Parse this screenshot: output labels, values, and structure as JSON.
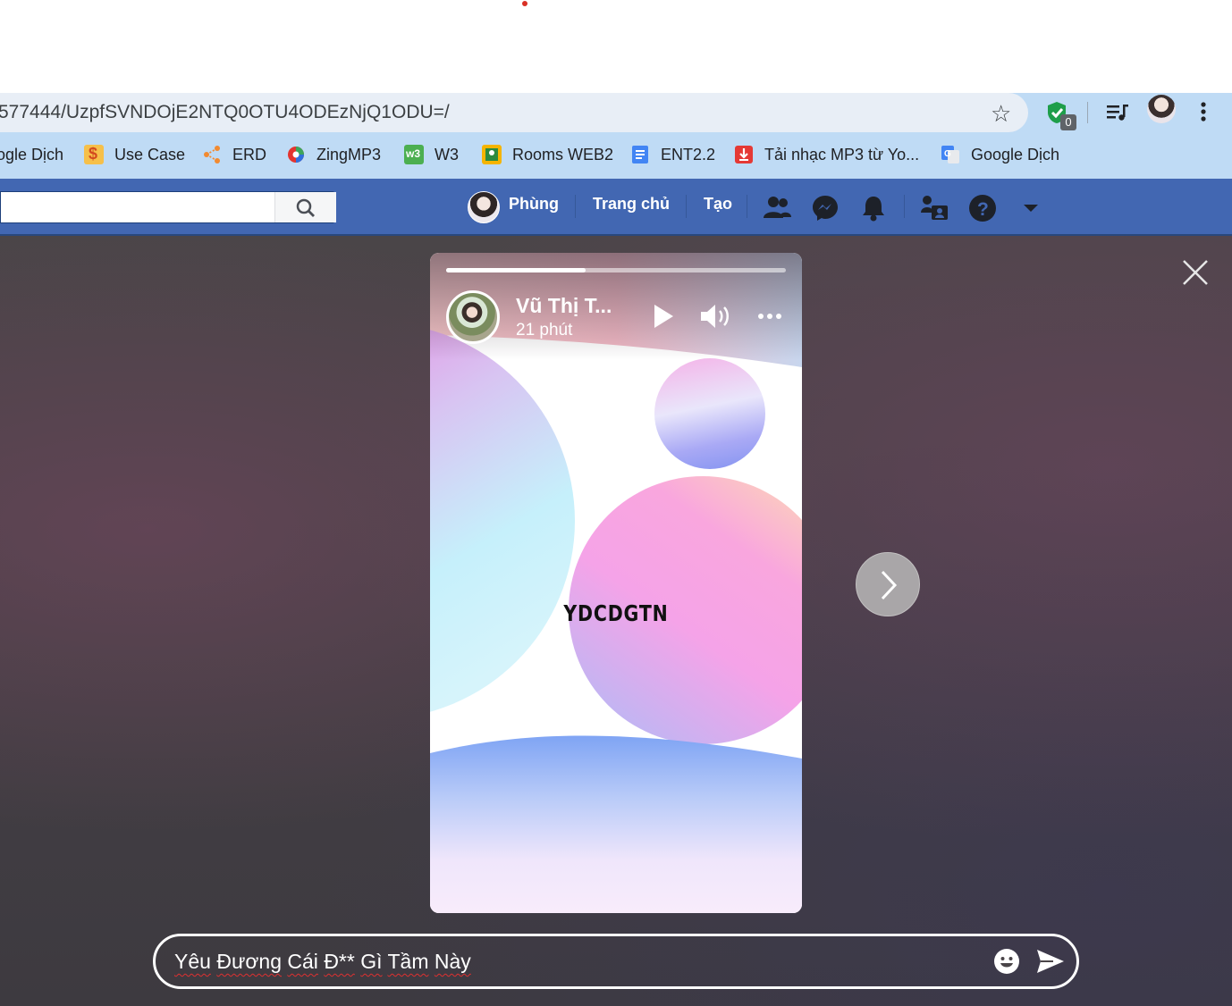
{
  "browser": {
    "url": "577444/UzpfSVNDOjE2NTQ0OTU4ODEzNjQ1ODU=/",
    "extension_badge": "0"
  },
  "bookmarks": [
    {
      "label": "ogle Dịch",
      "icon": "google-translate-icon"
    },
    {
      "label": "Use Case",
      "icon": "dollar-icon"
    },
    {
      "label": "ERD",
      "icon": "share-nodes-icon"
    },
    {
      "label": "ZingMP3",
      "icon": "zingmp3-icon"
    },
    {
      "label": "W3",
      "icon": "w3-icon"
    },
    {
      "label": "Rooms WEB2",
      "icon": "classroom-icon"
    },
    {
      "label": "ENT2.2",
      "icon": "docs-icon"
    },
    {
      "label": "Tải nhạc MP3 từ Yo...",
      "icon": "download-icon"
    },
    {
      "label": "Google Dịch",
      "icon": "google-translate-icon"
    }
  ],
  "facebook": {
    "user_name": "Phùng",
    "home": "Trang chủ",
    "create": "Tạo"
  },
  "story": {
    "author": "Vũ Thị T...",
    "time": "21 phút",
    "caption": "YDCDGTN",
    "progress": 0.41
  },
  "reply": {
    "text_words": [
      "Yêu",
      "Đương",
      "Cái",
      "Đ**",
      "Gì",
      "Tầm",
      "Này"
    ]
  },
  "colors": {
    "facebook_blue": "#4267b2",
    "bookmark_bar": "#bfdbf5"
  }
}
